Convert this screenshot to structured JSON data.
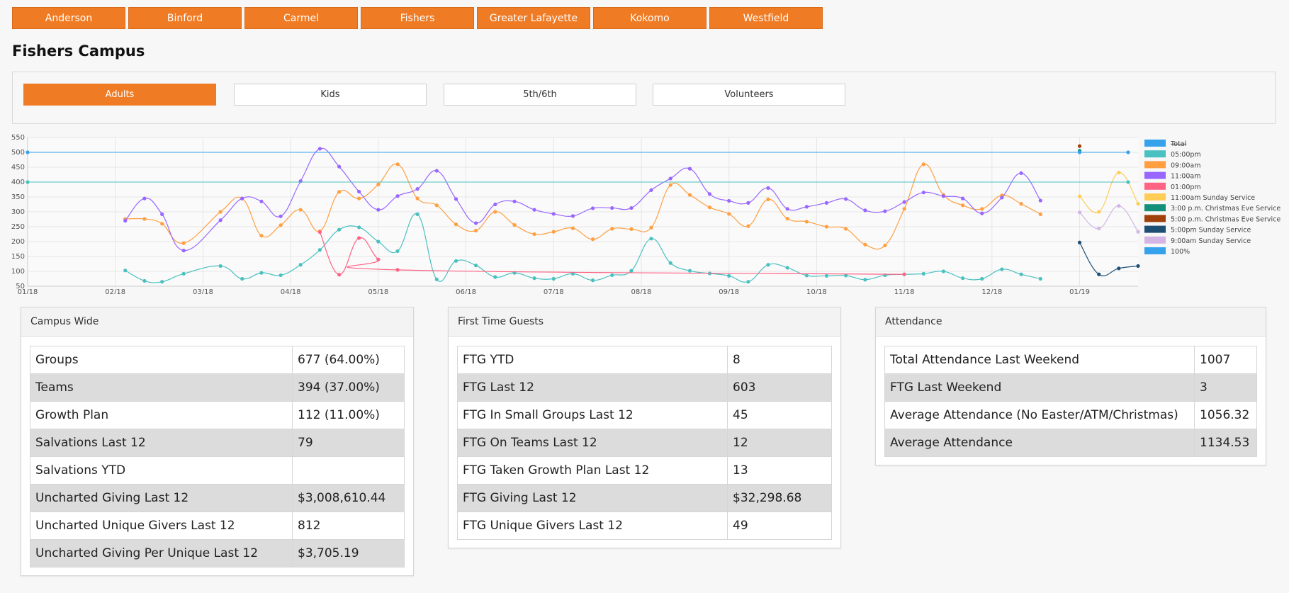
{
  "campus_tabs": [
    "Anderson",
    "Binford",
    "Carmel",
    "Fishers",
    "Greater Lafayette",
    "Kokomo",
    "Westfield"
  ],
  "page_title": "Fishers Campus",
  "sub_tabs": [
    "Adults",
    "Kids",
    "5th/6th",
    "Volunteers"
  ],
  "active_sub_tab": "Adults",
  "colors": {
    "accent": "#f07b25"
  },
  "chart_data": {
    "type": "line",
    "x_labels": [
      "01/18",
      "02/18",
      "03/18",
      "04/18",
      "05/18",
      "06/18",
      "07/18",
      "08/18",
      "09/18",
      "10/18",
      "11/18",
      "12/18",
      "01/19"
    ],
    "ylim": [
      50,
      550
    ],
    "y_ticks": [
      550,
      500,
      450,
      400,
      350,
      300,
      250,
      200,
      150,
      100,
      50
    ],
    "grid": true,
    "legend_position": "right",
    "legend": [
      {
        "name": "Total",
        "color": "#36a2eb",
        "struck": true
      },
      {
        "name": "05:00pm",
        "color": "#4bc0c0"
      },
      {
        "name": "09:00am",
        "color": "#ff9f40"
      },
      {
        "name": "11:00am",
        "color": "#9966ff"
      },
      {
        "name": "01:00pm",
        "color": "#ff6384"
      },
      {
        "name": "11:00am Sunday Service",
        "color": "#ffcd56"
      },
      {
        "name": "3:00 p.m. Christmas Eve Service",
        "color": "#138f7a"
      },
      {
        "name": "5:00 p.m. Christmas Eve Service",
        "color": "#a0400b"
      },
      {
        "name": "5:00pm Sunday Service",
        "color": "#1d4e74"
      },
      {
        "name": "9:00am Sunday Service",
        "color": "#d3b6e6"
      },
      {
        "name": "100%",
        "color": "#36a2eb"
      }
    ],
    "series": [
      {
        "name": "05:00pm",
        "color": "#4bc0c0",
        "points": [
          [
            1.67,
            103
          ],
          [
            2.0,
            68
          ],
          [
            2.3,
            65
          ],
          [
            2.67,
            92
          ],
          [
            3.3,
            118
          ],
          [
            3.67,
            75
          ],
          [
            4.0,
            95
          ],
          [
            4.33,
            87
          ],
          [
            4.67,
            122
          ],
          [
            5.0,
            172
          ],
          [
            5.33,
            240
          ],
          [
            5.67,
            248
          ],
          [
            6.0,
            200
          ],
          [
            6.33,
            168
          ],
          [
            6.67,
            292
          ],
          [
            7.0,
            73
          ],
          [
            7.33,
            135
          ],
          [
            7.67,
            120
          ],
          [
            8.0,
            81
          ],
          [
            8.33,
            95
          ],
          [
            8.67,
            77
          ],
          [
            9.0,
            75
          ],
          [
            9.33,
            92
          ],
          [
            9.67,
            70
          ],
          [
            10.0,
            87
          ],
          [
            10.33,
            102
          ],
          [
            10.67,
            210
          ],
          [
            11.0,
            128
          ],
          [
            11.33,
            102
          ],
          [
            11.67,
            93
          ],
          [
            12.0,
            85
          ],
          [
            12.33,
            65
          ],
          [
            12.67,
            122
          ],
          [
            13.0,
            112
          ],
          [
            13.33,
            86
          ],
          [
            13.67,
            85
          ],
          [
            14.0,
            86
          ],
          [
            14.33,
            72
          ],
          [
            14.67,
            87
          ],
          [
            15.0,
            90
          ],
          [
            15.33,
            92
          ],
          [
            15.67,
            100
          ],
          [
            16.0,
            77
          ],
          [
            16.33,
            75
          ],
          [
            16.67,
            107
          ],
          [
            17.0,
            90
          ],
          [
            17.33,
            75
          ]
        ]
      },
      {
        "name": "09:00am",
        "color": "#ff9f40",
        "points": [
          [
            1.67,
            276
          ],
          [
            2.0,
            276
          ],
          [
            2.3,
            260
          ],
          [
            2.67,
            195
          ],
          [
            3.3,
            300
          ],
          [
            3.67,
            345
          ],
          [
            4.0,
            220
          ],
          [
            4.33,
            255
          ],
          [
            4.67,
            307
          ],
          [
            5.0,
            235
          ],
          [
            5.33,
            367
          ],
          [
            5.67,
            345
          ],
          [
            6.0,
            392
          ],
          [
            6.33,
            460
          ],
          [
            6.67,
            345
          ],
          [
            7.0,
            322
          ],
          [
            7.33,
            258
          ],
          [
            7.67,
            237
          ],
          [
            8.0,
            300
          ],
          [
            8.33,
            256
          ],
          [
            8.67,
            225
          ],
          [
            9.0,
            233
          ],
          [
            9.33,
            245
          ],
          [
            9.67,
            208
          ],
          [
            10.0,
            243
          ],
          [
            10.33,
            242
          ],
          [
            10.67,
            247
          ],
          [
            11.0,
            390
          ],
          [
            11.33,
            357
          ],
          [
            11.67,
            315
          ],
          [
            12.0,
            293
          ],
          [
            12.33,
            252
          ],
          [
            12.67,
            342
          ],
          [
            13.0,
            277
          ],
          [
            13.33,
            267
          ],
          [
            13.67,
            250
          ],
          [
            14.0,
            243
          ],
          [
            14.33,
            190
          ],
          [
            14.67,
            187
          ],
          [
            15.0,
            310
          ],
          [
            15.33,
            460
          ],
          [
            15.67,
            357
          ],
          [
            16.0,
            322
          ],
          [
            16.33,
            310
          ],
          [
            16.67,
            355
          ],
          [
            17.0,
            327
          ],
          [
            17.33,
            292
          ]
        ]
      },
      {
        "name": "11:00am",
        "color": "#9966ff",
        "points": [
          [
            1.67,
            270
          ],
          [
            2.0,
            345
          ],
          [
            2.3,
            292
          ],
          [
            2.67,
            170
          ],
          [
            3.3,
            272
          ],
          [
            3.67,
            345
          ],
          [
            4.0,
            335
          ],
          [
            4.33,
            285
          ],
          [
            4.67,
            403
          ],
          [
            5.0,
            512
          ],
          [
            5.33,
            452
          ],
          [
            5.67,
            368
          ],
          [
            6.0,
            307
          ],
          [
            6.33,
            353
          ],
          [
            6.67,
            377
          ],
          [
            7.0,
            438
          ],
          [
            7.33,
            343
          ],
          [
            7.67,
            262
          ],
          [
            8.0,
            325
          ],
          [
            8.33,
            335
          ],
          [
            8.67,
            307
          ],
          [
            9.0,
            293
          ],
          [
            9.33,
            286
          ],
          [
            9.67,
            312
          ],
          [
            10.0,
            313
          ],
          [
            10.33,
            313
          ],
          [
            10.67,
            373
          ],
          [
            11.0,
            412
          ],
          [
            11.33,
            445
          ],
          [
            11.67,
            360
          ],
          [
            12.0,
            337
          ],
          [
            12.33,
            330
          ],
          [
            12.67,
            380
          ],
          [
            13.0,
            310
          ],
          [
            13.33,
            317
          ],
          [
            13.67,
            330
          ],
          [
            14.0,
            343
          ],
          [
            14.33,
            305
          ],
          [
            14.67,
            302
          ],
          [
            15.0,
            333
          ],
          [
            15.33,
            365
          ],
          [
            15.67,
            353
          ],
          [
            16.0,
            345
          ],
          [
            16.33,
            295
          ],
          [
            16.67,
            348
          ],
          [
            17.0,
            430
          ],
          [
            17.33,
            338
          ]
        ]
      },
      {
        "name": "01:00pm",
        "color": "#ff6384",
        "points": [
          [
            5.0,
            232
          ],
          [
            5.33,
            89
          ],
          [
            5.67,
            212
          ],
          [
            6.0,
            140
          ],
          [
            6.33,
            105
          ],
          [
            15.0,
            90
          ]
        ]
      },
      {
        "name": "11:00am Sunday Service",
        "color": "#ffcd56",
        "points": [
          [
            18.0,
            352
          ],
          [
            18.33,
            300
          ],
          [
            18.67,
            432
          ],
          [
            19.0,
            327
          ]
        ]
      },
      {
        "name": "9:00am Sunday Service",
        "color": "#d3b6e6",
        "points": [
          [
            18.0,
            298
          ],
          [
            18.33,
            244
          ],
          [
            18.67,
            320
          ],
          [
            19.0,
            233
          ]
        ]
      },
      {
        "name": "5:00pm Sunday Service",
        "color": "#1d4e74",
        "points": [
          [
            18.0,
            197
          ],
          [
            18.33,
            90
          ],
          [
            18.67,
            110
          ],
          [
            19.0,
            118
          ]
        ]
      },
      {
        "name": "3:00 p.m. Christmas Eve Service",
        "color": "#138f7a",
        "points": [
          [
            18.0,
            505
          ]
        ]
      },
      {
        "name": "5:00 p.m. Christmas Eve Service",
        "color": "#a0400b",
        "points": [
          [
            18.0,
            521
          ]
        ]
      },
      {
        "name": "Total baseline",
        "color": "#36a2eb",
        "points": [
          [
            0,
            500
          ],
          [
            18.0,
            500
          ],
          [
            18.83,
            500
          ]
        ]
      },
      {
        "name": "400 baseline",
        "color": "#4bc0c0",
        "points": [
          [
            0,
            400
          ],
          [
            18.83,
            400
          ]
        ]
      }
    ]
  },
  "campus_wide": {
    "title": "Campus Wide",
    "rows": [
      [
        "Groups",
        "677 (64.00%)"
      ],
      [
        "Teams",
        "394 (37.00%)"
      ],
      [
        "Growth Plan",
        "112 (11.00%)"
      ],
      [
        "Salvations Last 12",
        "79"
      ],
      [
        "Salvations YTD",
        ""
      ],
      [
        "Uncharted Giving Last 12",
        "$3,008,610.44"
      ],
      [
        "Uncharted Unique Givers Last 12",
        "812"
      ],
      [
        "Uncharted Giving Per Unique Last 12",
        "$3,705.19"
      ]
    ]
  },
  "first_time_guests": {
    "title": "First Time Guests",
    "rows": [
      [
        "FTG YTD",
        "8"
      ],
      [
        "FTG Last 12",
        "603"
      ],
      [
        "FTG In Small Groups Last 12",
        "45"
      ],
      [
        "FTG On Teams Last 12",
        "12"
      ],
      [
        "FTG Taken Growth Plan Last 12",
        "13"
      ],
      [
        "FTG Giving Last 12",
        "$32,298.68"
      ],
      [
        "FTG Unique Givers Last 12",
        "49"
      ]
    ]
  },
  "attendance": {
    "title": "Attendance",
    "rows": [
      [
        "Total Attendance Last Weekend",
        "1007"
      ],
      [
        "FTG Last Weekend",
        "3"
      ],
      [
        "Average Attendance (No Easter/ATM/Christmas)",
        "1056.32"
      ],
      [
        "Average Attendance",
        "1134.53"
      ]
    ]
  }
}
